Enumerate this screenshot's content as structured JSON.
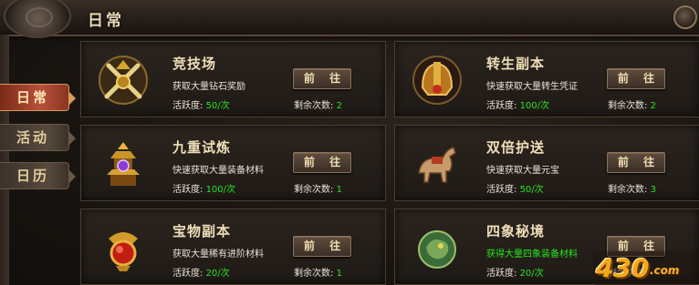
{
  "window": {
    "title": "日常"
  },
  "tabs": [
    {
      "label": "日常",
      "active": true
    },
    {
      "label": "活动",
      "active": false
    },
    {
      "label": "日历",
      "active": false
    }
  ],
  "labels": {
    "activity": "活跃度:",
    "remaining": "剩余次数:",
    "go": "前 往"
  },
  "cards": [
    {
      "name": "竞技场",
      "desc": "获取大量钻石奖励",
      "activity": "50/次",
      "remaining": "2",
      "icon": "crossed-swords-icon"
    },
    {
      "name": "转生副本",
      "desc": "快速获取大量转生凭证",
      "activity": "100/次",
      "remaining": "2",
      "icon": "helmet-icon"
    },
    {
      "name": "九重试炼",
      "desc": "快速获取大量装备材料",
      "activity": "100/次",
      "remaining": "1",
      "icon": "pagoda-icon"
    },
    {
      "name": "双倍护送",
      "desc": "快速获取大量元宝",
      "activity": "50/次",
      "remaining": "3",
      "icon": "horse-icon"
    },
    {
      "name": "宝物副本",
      "desc": "获取大量稀有进阶材料",
      "activity": "20/次",
      "remaining": "1",
      "icon": "red-gem-icon"
    },
    {
      "name": "四象秘境",
      "desc": "获得大量四象装备材料",
      "activity": "20/次",
      "remaining": "",
      "icon": "jade-beast-icon",
      "desc_color": "green"
    }
  ],
  "watermark": {
    "brand": "430",
    "suffix": ".com"
  }
}
